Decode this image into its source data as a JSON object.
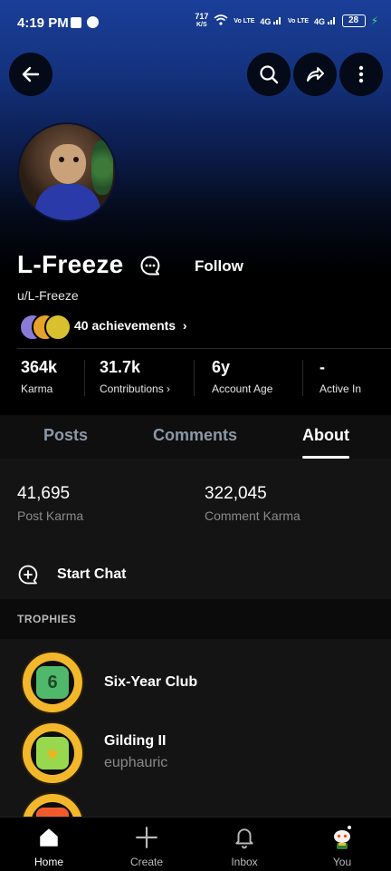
{
  "status_bar": {
    "time": "4:19 PM",
    "net_speed": "717",
    "net_unit": "K/S",
    "sim1_label": "Vo LTE",
    "sim1_net": "4G",
    "sim2_label": "Vo LTE",
    "sim2_net": "4G",
    "battery": "28"
  },
  "profile": {
    "display_name": "L-Freeze",
    "handle": "u/L-Freeze",
    "follow_label": "Follow",
    "achievements_label": "40 achievements"
  },
  "stats": [
    {
      "value": "364k",
      "label": "Karma"
    },
    {
      "value": "31.7k",
      "label": "Contributions"
    },
    {
      "value": "6y",
      "label": "Account Age"
    },
    {
      "value": "-",
      "label": "Active In"
    }
  ],
  "tabs": [
    {
      "label": "Posts",
      "active": false
    },
    {
      "label": "Comments",
      "active": false
    },
    {
      "label": "About",
      "active": true
    }
  ],
  "about": {
    "post_karma_value": "41,695",
    "post_karma_label": "Post Karma",
    "comment_karma_value": "322,045",
    "comment_karma_label": "Comment Karma",
    "start_chat_label": "Start Chat",
    "trophies_header": "TROPHIES",
    "trophies": [
      {
        "name": "Six-Year Club",
        "sub": ""
      },
      {
        "name": "Gilding II",
        "sub": "euphauric"
      }
    ]
  },
  "nav": [
    {
      "label": "Home",
      "icon": "home-icon",
      "active": true
    },
    {
      "label": "Create",
      "icon": "plus-icon",
      "active": false
    },
    {
      "label": "Inbox",
      "icon": "bell-icon",
      "active": false
    },
    {
      "label": "You",
      "icon": "avatar-icon",
      "active": false
    }
  ],
  "colors": {
    "accent_gold": "#f3b72b",
    "header_blue": "#1a3f99",
    "background": "#000000",
    "panel": "#141414"
  }
}
